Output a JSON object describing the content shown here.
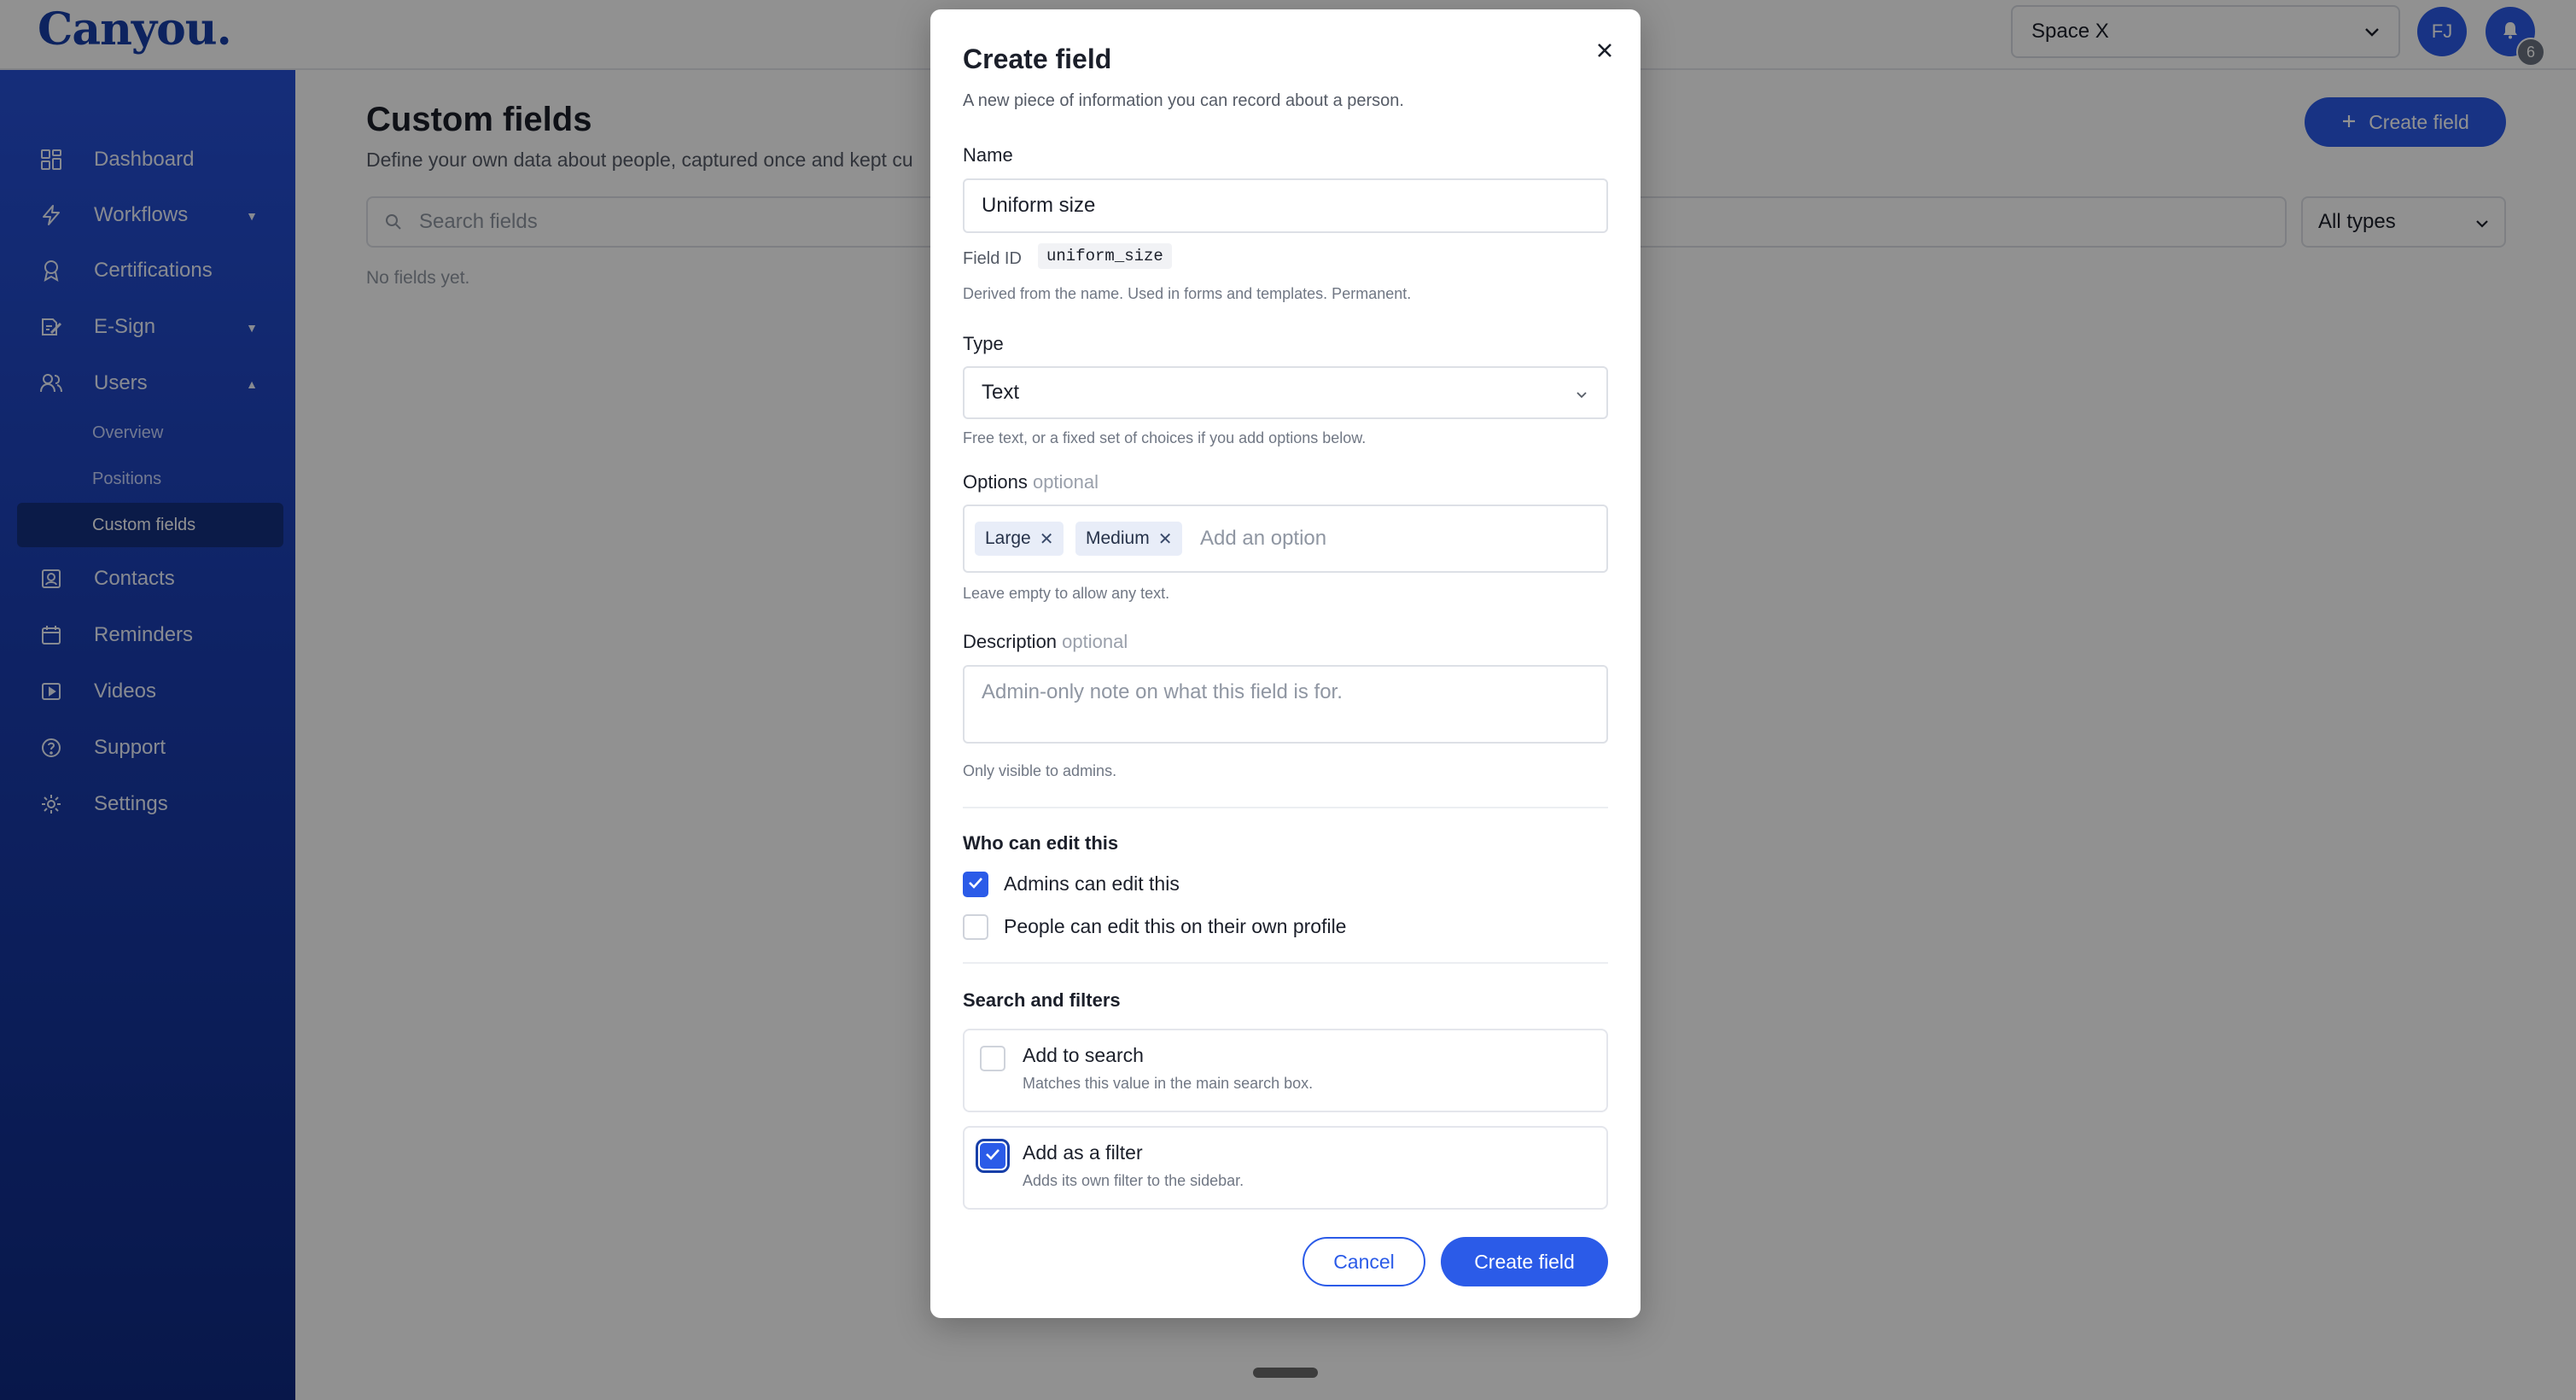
{
  "app": {
    "logo_text": "Canyou."
  },
  "topbar": {
    "space_selected": "Space X",
    "avatar_initials": "FJ",
    "notifications_count": "6"
  },
  "sidebar": {
    "items": [
      {
        "label": "Dashboard",
        "icon": "dashboard-icon"
      },
      {
        "label": "Workflows",
        "icon": "lightning-icon",
        "caret": "down"
      },
      {
        "label": "Certifications",
        "icon": "award-icon"
      },
      {
        "label": "E-Sign",
        "icon": "signature-icon",
        "caret": "down"
      },
      {
        "label": "Users",
        "icon": "users-icon",
        "caret": "up"
      },
      {
        "label": "Contacts",
        "icon": "contacts-icon"
      },
      {
        "label": "Reminders",
        "icon": "calendar-icon"
      },
      {
        "label": "Videos",
        "icon": "video-icon"
      },
      {
        "label": "Support",
        "icon": "help-icon"
      },
      {
        "label": "Settings",
        "icon": "gear-icon"
      }
    ],
    "users_subitems": [
      {
        "label": "Overview"
      },
      {
        "label": "Positions"
      },
      {
        "label": "Custom fields",
        "active": true
      }
    ]
  },
  "main": {
    "title": "Custom fields",
    "subtitle": "Define your own data about people, captured once and kept cu",
    "create_button": "Create field",
    "search_placeholder": "Search fields",
    "type_filter": "All types",
    "empty_text": "No fields yet."
  },
  "modal": {
    "title": "Create field",
    "subtitle": "A new piece of information you can record about a person.",
    "name_label": "Name",
    "name_value": "Uniform size",
    "field_id_label": "Field ID",
    "field_id_value": "uniform_size",
    "field_id_hint": "Derived from the name. Used in forms and templates. Permanent.",
    "type_label": "Type",
    "type_value": "Text",
    "type_hint": "Free text, or a fixed set of choices if you add options below.",
    "options_label": "Options",
    "optional_text": "optional",
    "options": [
      "Large",
      "Medium"
    ],
    "options_placeholder": "Add an option",
    "options_hint": "Leave empty to allow any text.",
    "description_label": "Description",
    "description_placeholder": "Admin-only note on what this field is for.",
    "description_hint": "Only visible to admins.",
    "who_can_edit_heading": "Who can edit this",
    "admins_can_edit": {
      "label": "Admins can edit this",
      "checked": true
    },
    "people_can_edit": {
      "label": "People can edit this on their own profile",
      "checked": false
    },
    "search_filters_heading": "Search and filters",
    "add_to_search": {
      "title": "Add to search",
      "hint": "Matches this value in the main search box.",
      "checked": false
    },
    "add_as_filter": {
      "title": "Add as a filter",
      "hint": "Adds its own filter to the sidebar.",
      "checked": true
    },
    "cancel_button": "Cancel",
    "create_button": "Create field"
  },
  "colors": {
    "accent": "#2b5be8",
    "sidebar_top": "#2650d6",
    "sidebar_bottom": "#0f2a83",
    "overlay": "rgba(0,0,0,0.43)"
  }
}
